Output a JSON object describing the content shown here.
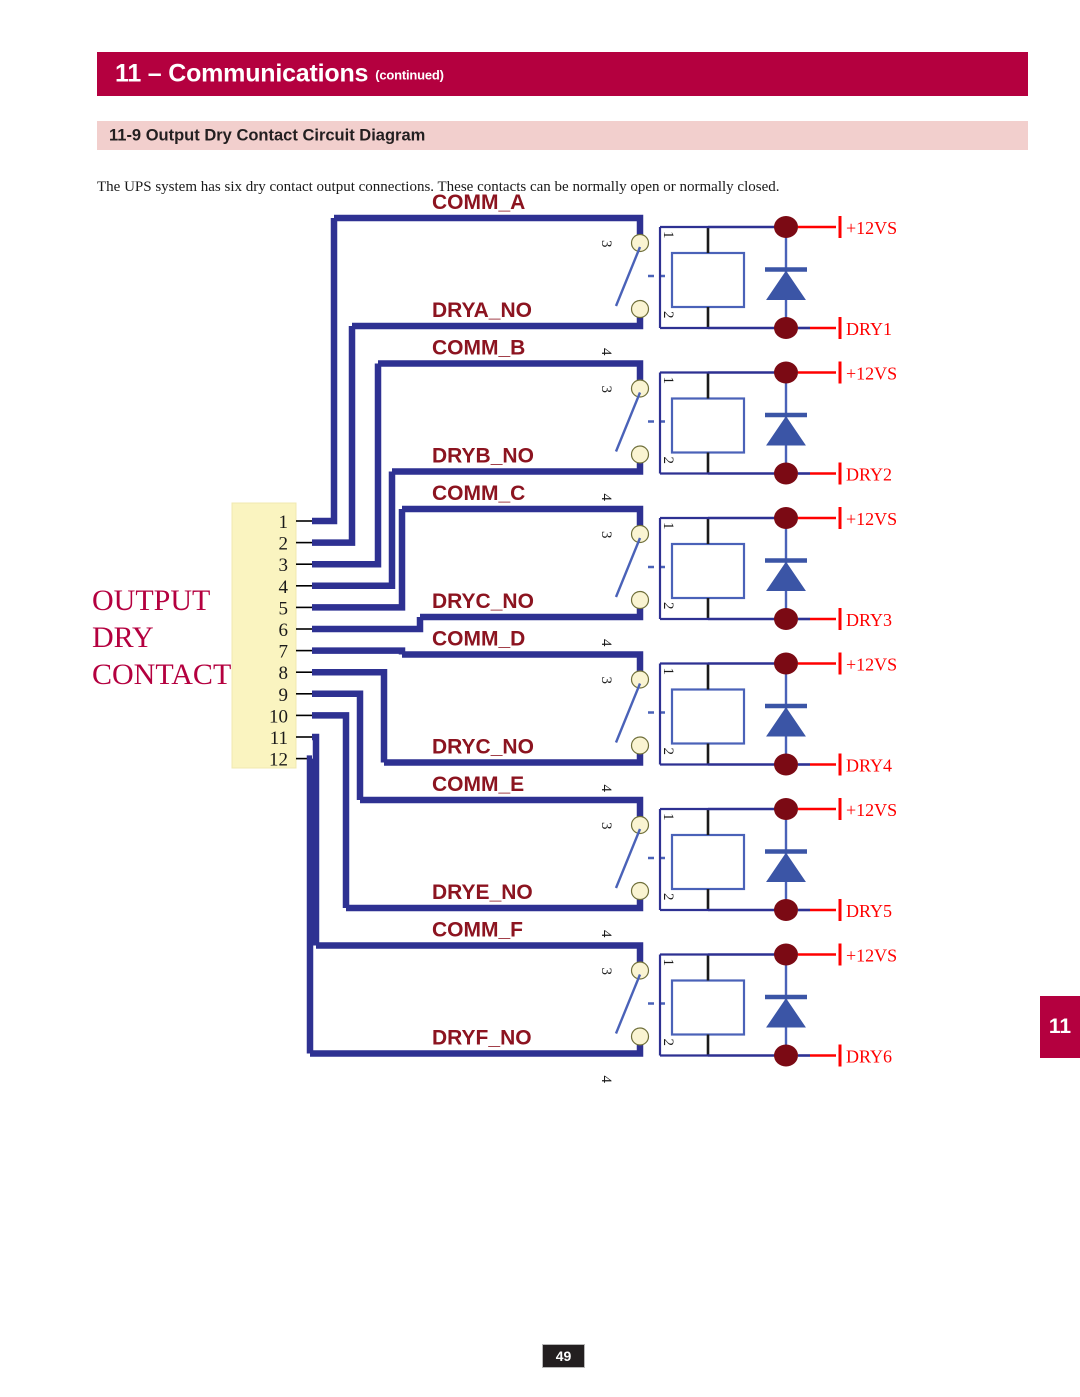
{
  "header": {
    "title": "11 – Communications",
    "continued": "(continued)",
    "bar_color": "#b4003f"
  },
  "subsection": {
    "title": "11-9 Output Dry Contact Circuit Diagram",
    "bar_color": "#f2cfcd"
  },
  "intro": {
    "text": "The UPS system has six dry contact output connections. These contacts can be normally open or normally closed."
  },
  "side_tab": {
    "label": "11",
    "color": "#b4003f"
  },
  "footer": {
    "page_number": "49"
  },
  "diagram": {
    "block_label_lines": [
      "OUTPUT",
      "DRY",
      "CONTACT"
    ],
    "block_label_color": "#b4003f",
    "terminal_block": {
      "fill": "#faf4c0",
      "pins": [
        "1",
        "2",
        "3",
        "4",
        "5",
        "6",
        "7",
        "8",
        "9",
        "10",
        "11",
        "12"
      ]
    },
    "wire_color": "#2e3192",
    "signal_color": "#ff0000",
    "node_color": "#7b0a14",
    "contact_color": "#faf4d2",
    "coil_color": "#4a62b8",
    "diode_color": "#3b55a6",
    "rows": [
      {
        "comm_label": "COMM_A",
        "no_label": "DRYA_NO",
        "comm_terminal": "3",
        "no_terminal": "4",
        "coil_pin_top": "1",
        "coil_pin_bottom": "2",
        "supply_label": "+12VS",
        "dry_label": "DRY1"
      },
      {
        "comm_label": "COMM_B",
        "no_label": "DRYB_NO",
        "comm_terminal": "3",
        "no_terminal": "4",
        "coil_pin_top": "1",
        "coil_pin_bottom": "2",
        "supply_label": "+12VS",
        "dry_label": "DRY2"
      },
      {
        "comm_label": "COMM_C",
        "no_label": "DRYC_NO",
        "comm_terminal": "3",
        "no_terminal": "4",
        "coil_pin_top": "1",
        "coil_pin_bottom": "2",
        "supply_label": "+12VS",
        "dry_label": "DRY3"
      },
      {
        "comm_label": "COMM_D",
        "no_label": "DRYC_NO",
        "comm_terminal": "3",
        "no_terminal": "4",
        "coil_pin_top": "1",
        "coil_pin_bottom": "2",
        "supply_label": "+12VS",
        "dry_label": "DRY4"
      },
      {
        "comm_label": "COMM_E",
        "no_label": "DRYE_NO",
        "comm_terminal": "3",
        "no_terminal": "4",
        "coil_pin_top": "1",
        "coil_pin_bottom": "2",
        "supply_label": "+12VS",
        "dry_label": "DRY5"
      },
      {
        "comm_label": "COMM_F",
        "no_label": "DRYF_NO",
        "comm_terminal": "3",
        "no_terminal": "4",
        "coil_pin_top": "1",
        "coil_pin_bottom": "2",
        "supply_label": "+12VS",
        "dry_label": "DRY6"
      }
    ]
  }
}
